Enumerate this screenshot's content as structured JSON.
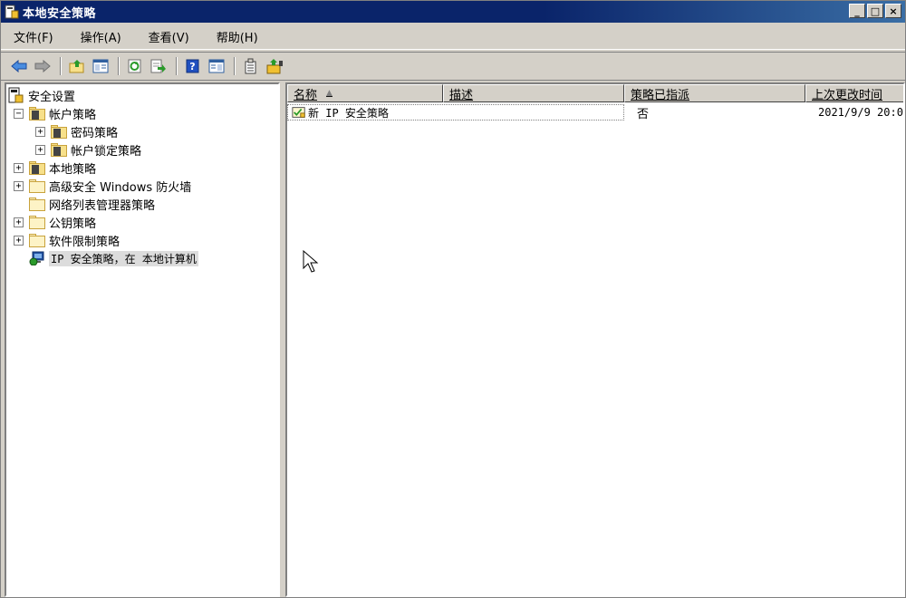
{
  "window": {
    "title": "本地安全策略",
    "controls": {
      "minimize": "_",
      "maximize": "□",
      "close": "×"
    }
  },
  "menu": {
    "items": [
      "文件(F)",
      "操作(A)",
      "查看(V)",
      "帮助(H)"
    ]
  },
  "toolbar": {
    "icons": [
      "back-arrow-icon",
      "forward-arrow-icon",
      "up-folder-icon",
      "show-hide-tree-icon",
      "refresh-icon",
      "export-list-icon",
      "help-icon",
      "properties-icon",
      "manage-filters-icon",
      "assign-policy-icon"
    ]
  },
  "tree": {
    "items": [
      {
        "label": "安全设置",
        "level": 0,
        "expander": "",
        "icon": "security-settings-icon"
      },
      {
        "label": "帐户策略",
        "level": 1,
        "expander": "−",
        "icon": "policy-folder-icon"
      },
      {
        "label": "密码策略",
        "level": 2,
        "expander": "+",
        "icon": "policy-folder-icon"
      },
      {
        "label": "帐户锁定策略",
        "level": 2,
        "expander": "+",
        "icon": "policy-folder-icon"
      },
      {
        "label": "本地策略",
        "level": 1,
        "expander": "+",
        "icon": "policy-folder-icon"
      },
      {
        "label": "高级安全 Windows 防火墙",
        "level": 1,
        "expander": "+",
        "icon": "folder-icon"
      },
      {
        "label": "网络列表管理器策略",
        "level": 1,
        "expander": "",
        "icon": "folder-icon"
      },
      {
        "label": "公钥策略",
        "level": 1,
        "expander": "+",
        "icon": "folder-icon"
      },
      {
        "label": "软件限制策略",
        "level": 1,
        "expander": "+",
        "icon": "folder-icon"
      },
      {
        "label": "IP 安全策略，在 本地计算机",
        "level": 1,
        "expander": "",
        "icon": "ip-security-icon",
        "selected": true
      }
    ]
  },
  "list": {
    "columns": [
      {
        "label": "名称",
        "sort": "▲"
      },
      {
        "label": "描述"
      },
      {
        "label": "策略已指派"
      },
      {
        "label": "上次更改时间"
      }
    ],
    "rows": [
      {
        "name": "新 IP 安全策略",
        "description": "",
        "assigned": "否",
        "modified": "2021/9/9 20:0"
      }
    ]
  },
  "colors": {
    "titlebar": "#0a246a",
    "chrome": "#d4d0c8",
    "selection": "#dcdcdc"
  }
}
